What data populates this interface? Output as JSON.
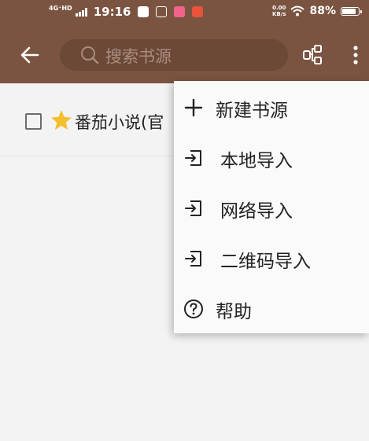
{
  "status_bar": {
    "signal_label": "4G⁺HD",
    "time": "19:16",
    "net_speed_value": "0.00",
    "net_speed_unit": "KB/s",
    "battery_percent": "88%",
    "battery_level": 0.88
  },
  "toolbar": {
    "search_placeholder": "搜索书源"
  },
  "sources": [
    {
      "name": "番茄小说(官",
      "checked": false,
      "icon": "star-icon"
    }
  ],
  "menu": {
    "items": [
      {
        "label": "新建书源",
        "icon": "plus-icon"
      },
      {
        "label": "本地导入",
        "icon": "import-icon"
      },
      {
        "label": "网络导入",
        "icon": "import-icon"
      },
      {
        "label": "二维码导入",
        "icon": "import-icon"
      },
      {
        "label": "帮助",
        "icon": "help-icon"
      }
    ]
  },
  "colors": {
    "app_bar": "#7a5440",
    "search_bg": "#6c4837",
    "background": "#f3f3f3",
    "menu_bg": "#fafafa"
  }
}
